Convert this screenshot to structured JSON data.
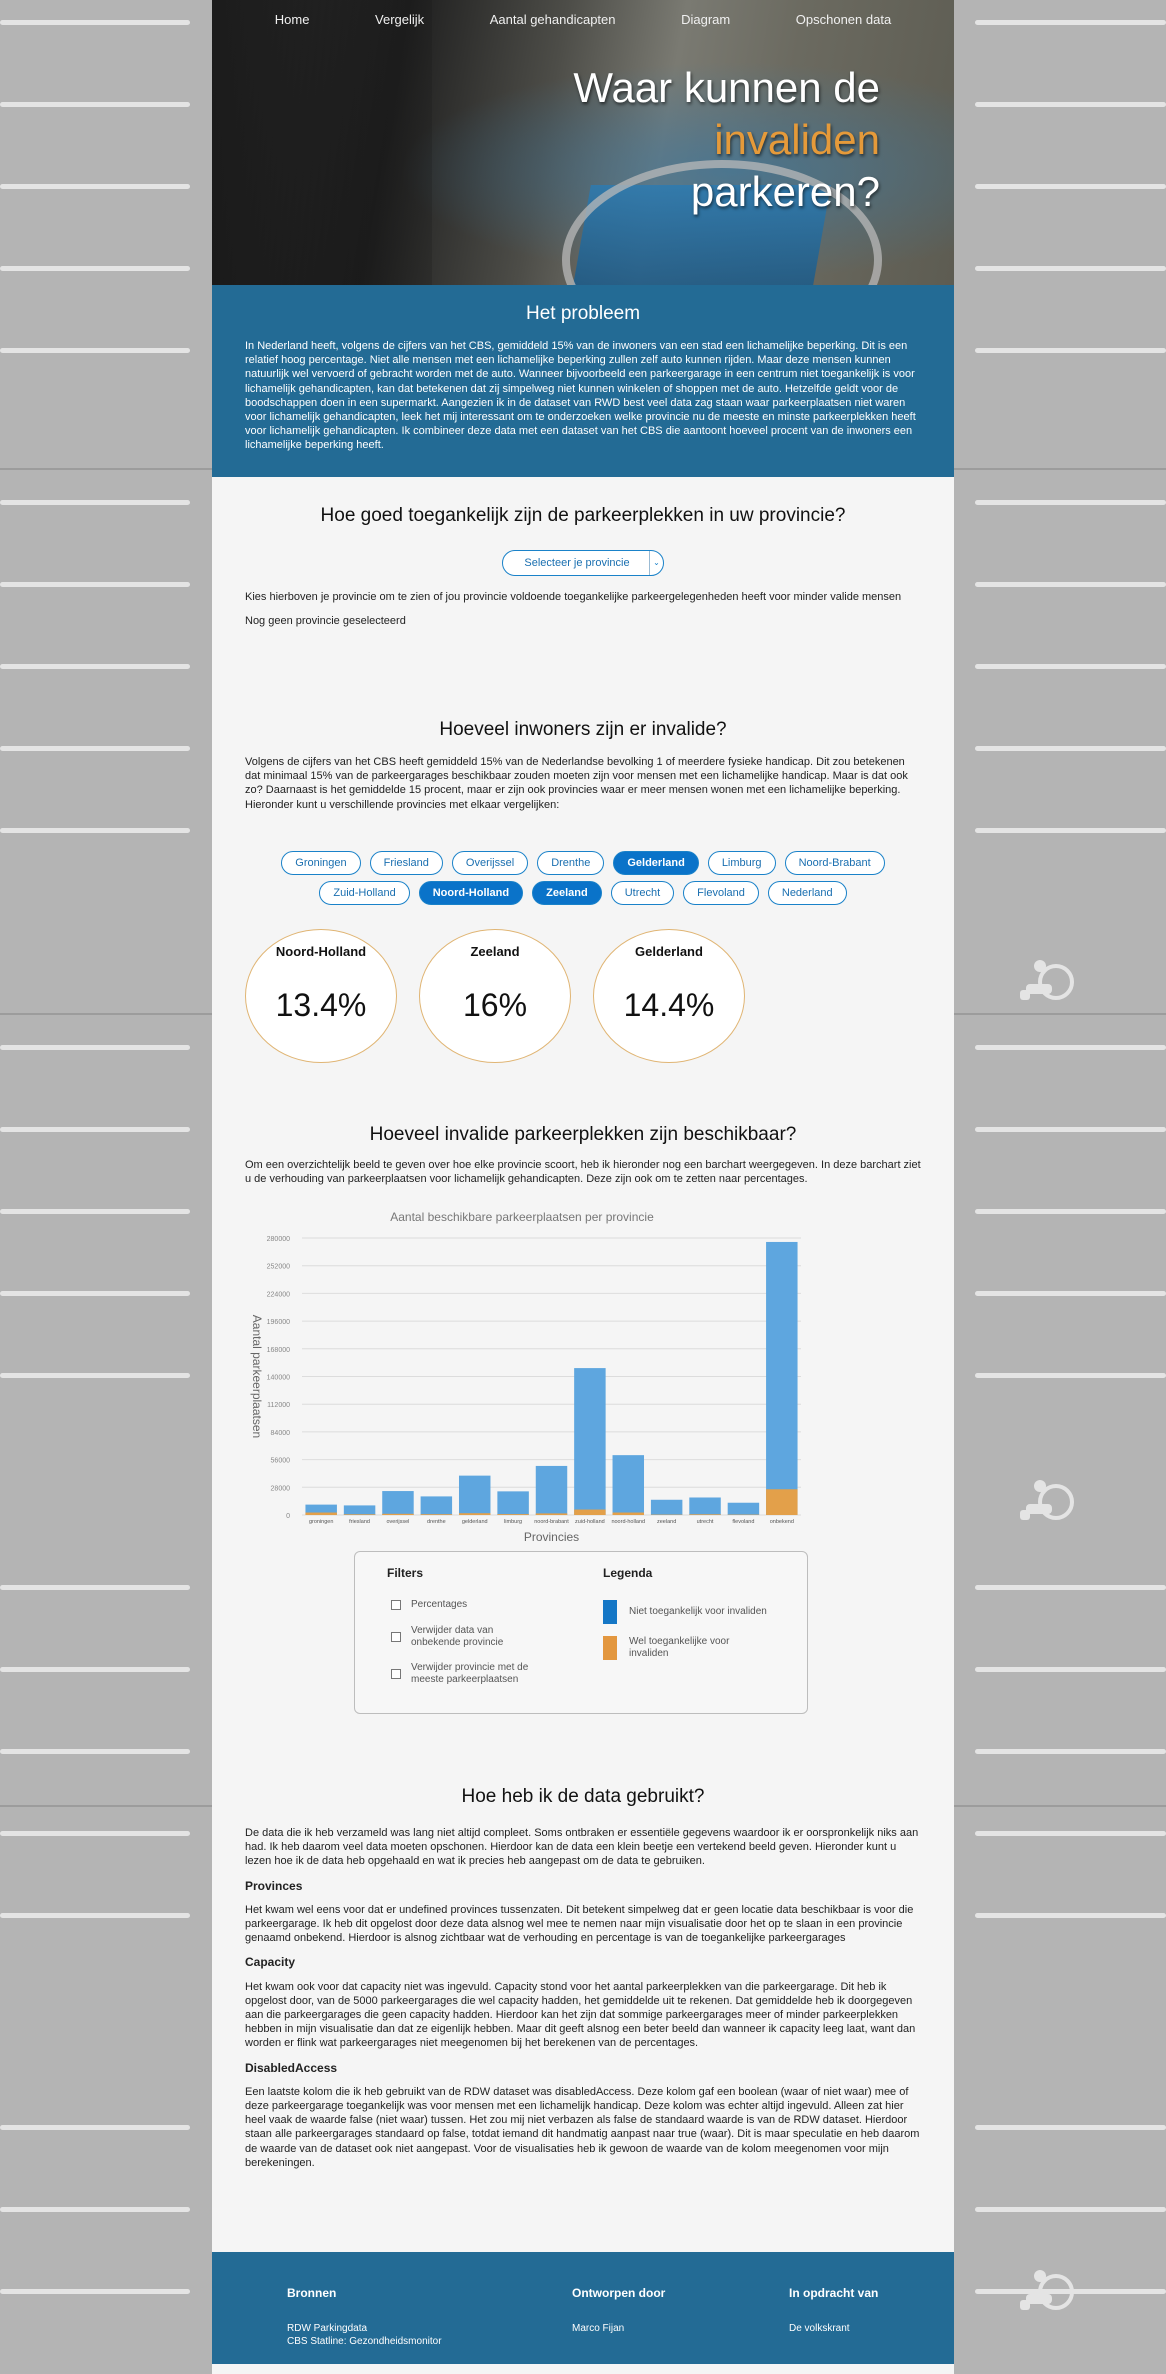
{
  "nav": [
    "Home",
    "Vergelijk",
    "Aantal gehandicapten",
    "Diagram",
    "Opschonen data"
  ],
  "hero": {
    "title_line1": "Waar kunnen de",
    "title_accent": "invaliden",
    "title_line3": "parkeren?"
  },
  "problem": {
    "heading": "Het probleem",
    "text": "In Nederland heeft, volgens de cijfers van het CBS, gemiddeld 15% van de inwoners van een stad een lichamelijke beperking. Dit is een relatief hoog percentage. Niet alle mensen met een lichamelijke beperking zullen zelf auto kunnen rijden. Maar deze mensen kunnen natuurlijk wel vervoerd of gebracht worden met de auto. Wanneer bijvoorbeeld een parkeergarage in een centrum niet toegankelijk is voor lichamelijk gehandicapten, kan dat betekenen dat zij simpelweg niet kunnen winkelen of shoppen met de auto. Hetzelfde geldt voor de boodschappen doen in een supermarkt. Aangezien ik in de dataset van RWD best veel data zag staan waar parkeerplaatsen niet waren voor lichamelijk gehandicapten, leek het mij interessant om te onderzoeken welke provincie nu de meeste en minste parkeerplekken heeft voor lichamelijk gehandicapten. Ik combineer deze data met een dataset van het CBS die aantoont hoeveel procent van de inwoners een lichamelijke beperking heeft."
  },
  "access": {
    "heading": "Hoe goed toegankelijk zijn de parkeerplekken in uw provincie?",
    "select_label": "Selecteer je provincie",
    "select_caret": "⌄",
    "hint": "Kies hierboven je provincie om te zien of jou provincie voldoende toegankelijke parkeergelegenheden heeft voor minder valide mensen",
    "status": "Nog geen provincie geselecteerd"
  },
  "inhabitants": {
    "heading": "Hoeveel inwoners zijn er invalide?",
    "text": "Volgens de cijfers van het CBS heeft gemiddeld 15% van de Nederlandse bevolking 1 of meerdere fysieke handicap. Dit zou betekenen dat minimaal 15% van de parkeergarages beschikbaar zouden moeten zijn voor mensen met een lichamelijke handicap. Maar is dat ook zo? Daarnaast is het gemiddelde 15 procent, maar er zijn ook provincies waar er meer mensen wonen met een lichamelijke beperking. Hieronder kunt u verschillende provincies met elkaar vergelijken:",
    "pills": [
      {
        "label": "Groningen",
        "active": false
      },
      {
        "label": "Friesland",
        "active": false
      },
      {
        "label": "Overijssel",
        "active": false
      },
      {
        "label": "Drenthe",
        "active": false
      },
      {
        "label": "Gelderland",
        "active": true
      },
      {
        "label": "Limburg",
        "active": false
      },
      {
        "label": "Noord-Brabant",
        "active": false
      },
      {
        "label": "Zuid-Holland",
        "active": false
      },
      {
        "label": "Noord-Holland",
        "active": true
      },
      {
        "label": "Zeeland",
        "active": true
      },
      {
        "label": "Utrecht",
        "active": false
      },
      {
        "label": "Flevoland",
        "active": false
      },
      {
        "label": "Nederland",
        "active": false
      }
    ],
    "circles": [
      {
        "name": "Noord-Holland",
        "value": "13.4%"
      },
      {
        "name": "Zeeland",
        "value": "16%"
      },
      {
        "name": "Gelderland",
        "value": "14.4%"
      }
    ]
  },
  "availability": {
    "heading": "Hoeveel invalide parkeerplekken zijn beschikbaar?",
    "text": "Om een overzichtelijk beeld te geven over hoe elke provincie scoort, heb ik hieronder nog een barchart weergegeven. In deze barchart ziet u de verhouding van parkeerplaatsen voor lichamelijk gehandicapten. Deze zijn ook om te zetten naar percentages."
  },
  "chart_data": {
    "type": "bar",
    "title": "Aantal beschikbare parkeerplaatsen per provincie",
    "xlabel": "Provincies",
    "ylabel": "Aantal parkeerplaatsen",
    "ylim": [
      0,
      280000
    ],
    "yticks": [
      0,
      28000,
      56000,
      84000,
      112000,
      140000,
      168000,
      196000,
      224000,
      252000,
      280000
    ],
    "categories": [
      "groningen",
      "friesland",
      "overijssel",
      "drenthe",
      "gelderland",
      "limburg",
      "noord-brabant",
      "zuid-holland",
      "noord-holland",
      "zeeland",
      "utrecht",
      "flevoland",
      "onbekend"
    ],
    "series": [
      {
        "name": "Niet toegankelijk voor invaliden",
        "color": "#5ea6df",
        "values": [
          8000,
          9000,
          23000,
          18000,
          38000,
          23000,
          48000,
          143000,
          58000,
          15000,
          17000,
          12000,
          250000
        ]
      },
      {
        "name": "Wel toegankelijke voor invaliden",
        "color": "#e3a04a",
        "values": [
          2500,
          700,
          1200,
          800,
          1800,
          900,
          1600,
          5500,
          2500,
          400,
          700,
          400,
          26000
        ]
      }
    ],
    "grid": true
  },
  "filters": {
    "title": "Filters",
    "items": [
      "Percentages",
      "Verwijder data van onbekende provincie",
      "Verwijder provincie met de meeste parkeerplaatsen"
    ]
  },
  "legend": {
    "title": "Legenda",
    "items": [
      {
        "label": "Niet toegankelijk voor invaliden",
        "color": "#1577c6"
      },
      {
        "label": "Wel toegankelijke voor invaliden",
        "color": "#e3973f"
      }
    ]
  },
  "data_usage": {
    "heading": "Hoe heb ik de data gebruikt?",
    "intro": "De data die ik heb verzameld was lang niet altijd compleet. Soms ontbraken er essentiële gegevens waardoor ik er oorspronkelijk niks aan had. Ik heb daarom veel data moeten opschonen. Hierdoor kan de data een klein beetje een vertekend beeld geven. Hieronder kunt u lezen hoe ik de data heb opgehaald en wat ik precies heb aangepast om de data te gebruiken.",
    "sections": [
      {
        "title": "Provinces",
        "text": "Het kwam wel eens voor dat er undefined provinces tussenzaten. Dit betekent simpelweg dat er geen locatie data beschikbaar is voor die parkeergarage. Ik heb dit opgelost door deze data alsnog wel mee te nemen naar mijn visualisatie door het op te slaan in een provincie genaamd onbekend. Hierdoor is alsnog zichtbaar wat de verhouding en percentage is van de toegankelijke parkeergarages"
      },
      {
        "title": "Capacity",
        "text": "Het kwam ook voor dat capacity niet was ingevuld. Capacity stond voor het aantal parkeerplekken van die parkeergarage. Dit heb ik opgelost door, van de 5000 parkeergarages die wel capacity hadden, het gemiddelde uit te rekenen. Dat gemiddelde heb ik doorgegeven aan die parkeergarages die geen capacity hadden. Hierdoor kan het zijn dat sommige parkeergarages meer of minder parkeerplekken hebben in mijn visualisatie dan dat ze eigenlijk hebben. Maar dit geeft alsnog een beter beeld dan wanneer ik capacity leeg laat, want dan worden er flink wat parkeergarages niet meegenomen bij het berekenen van de percentages."
      },
      {
        "title": "DisabledAccess",
        "text": "Een laatste kolom die ik heb gebruikt van de RDW dataset was disabledAccess. Deze kolom gaf een boolean (waar of niet waar) mee of deze parkeergarage toegankelijk was voor mensen met een lichamelijk handicap. Deze kolom was echter altijd ingevuld. Alleen zat hier heel vaak de waarde false (niet waar) tussen. Het zou mij niet verbazen als false de standaard waarde is van de RDW dataset. Hierdoor staan alle parkeergarages standaard op false, totdat iemand dit handmatig aanpast naar true (waar). Dit is maar speculatie en heb daarom de waarde van de dataset ook niet aangepast. Voor de visualisaties heb ik gewoon de waarde van de kolom meegenomen voor mijn berekeningen."
      }
    ]
  },
  "footer": {
    "sources": {
      "title": "Bronnen",
      "lines": [
        "RDW Parkingdata",
        "CBS Statline: Gezondheidsmonitor"
      ]
    },
    "design": {
      "title": "Ontworpen door",
      "lines": [
        "Marco Fijan"
      ]
    },
    "client": {
      "title": "In opdracht van",
      "lines": [
        "De volkskrant"
      ]
    }
  }
}
